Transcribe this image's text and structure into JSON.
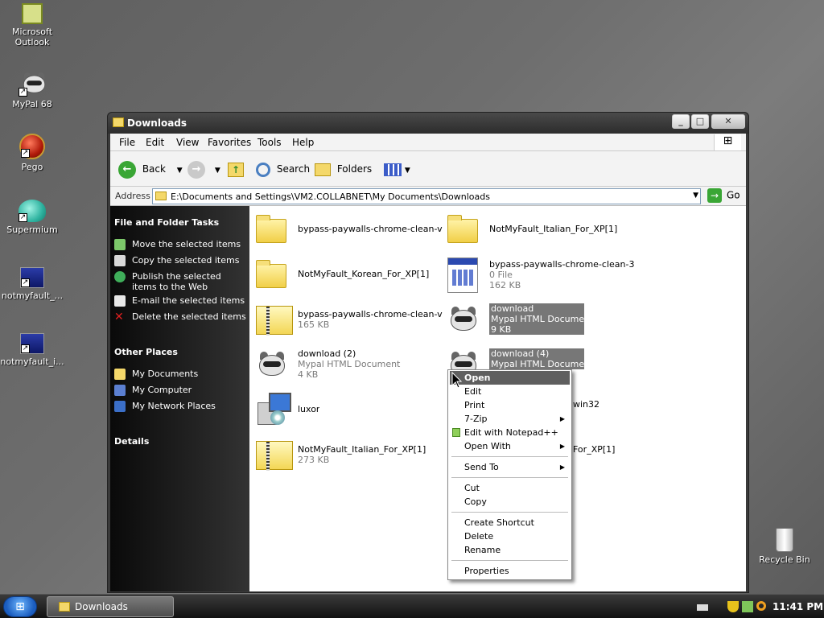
{
  "desktop": {
    "icons": [
      {
        "label": "Microsoft Outlook",
        "icon": "outlook-icon"
      },
      {
        "label": "MyPal 68",
        "icon": "mypal-icon"
      },
      {
        "label": "Pego",
        "icon": "pego-icon"
      },
      {
        "label": "Supermium",
        "icon": "supermium-icon"
      },
      {
        "label": "notmyfault_...",
        "icon": "notmyfault-icon"
      },
      {
        "label": "notmyfault_i...",
        "icon": "notmyfault-icon"
      },
      {
        "label": "Recycle Bin",
        "icon": "recycle-bin-icon"
      }
    ]
  },
  "window": {
    "title": "Downloads",
    "controls": {
      "minimize": "_",
      "maximize": "□",
      "close": "✕"
    },
    "menu": [
      "File",
      "Edit",
      "View",
      "Favorites",
      "Tools",
      "Help"
    ],
    "toolbar": {
      "back": "Back",
      "search": "Search",
      "folders": "Folders"
    },
    "address": {
      "label": "Address",
      "value": "E:\\Documents and Settings\\VM2.COLLABNET\\My Documents\\Downloads",
      "go": "Go"
    },
    "left_pane": {
      "file_tasks_header": "File and Folder Tasks",
      "file_tasks": [
        "Move the selected items",
        "Copy the selected items",
        "Publish the selected items to the Web",
        "E-mail the selected items",
        "Delete the selected items"
      ],
      "other_places_header": "Other Places",
      "other_places": [
        "My Documents",
        "My Computer",
        "My Network Places"
      ],
      "details_header": "Details"
    },
    "files": [
      {
        "name": "bypass-paywalls-chrome-clean-v...",
        "sub1": "",
        "sub2": "",
        "kind": "folder"
      },
      {
        "name": "NotMyFault_Italian_For_XP[1]",
        "sub1": "",
        "sub2": "",
        "kind": "folder"
      },
      {
        "name": "NotMyFault_Korean_For_XP[1]",
        "sub1": "",
        "sub2": "",
        "kind": "folder"
      },
      {
        "name": "bypass-paywalls-chrome-clean-3....",
        "sub1": "0 File",
        "sub2": "162 KB",
        "kind": "document"
      },
      {
        "name": "bypass-paywalls-chrome-clean-v...",
        "sub1": "165 KB",
        "sub2": "",
        "kind": "zip"
      },
      {
        "name": "download",
        "sub1": "Mypal HTML Document",
        "sub2": "9 KB",
        "kind": "mypal",
        "selected": true
      },
      {
        "name": "download (2)",
        "sub1": "Mypal HTML Document",
        "sub2": "4 KB",
        "kind": "mypal"
      },
      {
        "name": "download (4)",
        "sub1": "Mypal HTML Document",
        "sub2": "",
        "kind": "mypal",
        "selected": true
      },
      {
        "name": "luxor",
        "sub1": "",
        "sub2": "",
        "kind": "setup"
      },
      {
        "name": "win32",
        "sub1": "",
        "sub2": "",
        "kind": "zip"
      },
      {
        "name": "NotMyFault_Italian_For_XP[1]",
        "sub1": "273 KB",
        "sub2": "",
        "kind": "zip"
      },
      {
        "name": "For_XP[1]",
        "sub1": "",
        "sub2": "",
        "kind": "zip"
      }
    ]
  },
  "context_menu": {
    "items": [
      {
        "label": "Open",
        "highlighted": true
      },
      {
        "label": "Edit"
      },
      {
        "label": "Print"
      },
      {
        "label": "7-Zip",
        "submenu": true
      },
      {
        "label": "Edit with Notepad++"
      },
      {
        "label": "Open With",
        "submenu": true
      },
      {
        "label": "Send To",
        "submenu": true
      },
      {
        "label": "Cut"
      },
      {
        "label": "Copy"
      },
      {
        "label": "Create Shortcut"
      },
      {
        "label": "Delete"
      },
      {
        "label": "Rename"
      },
      {
        "label": "Properties"
      }
    ]
  },
  "taskbar": {
    "active_window": "Downloads",
    "clock": "11:41 PM"
  }
}
